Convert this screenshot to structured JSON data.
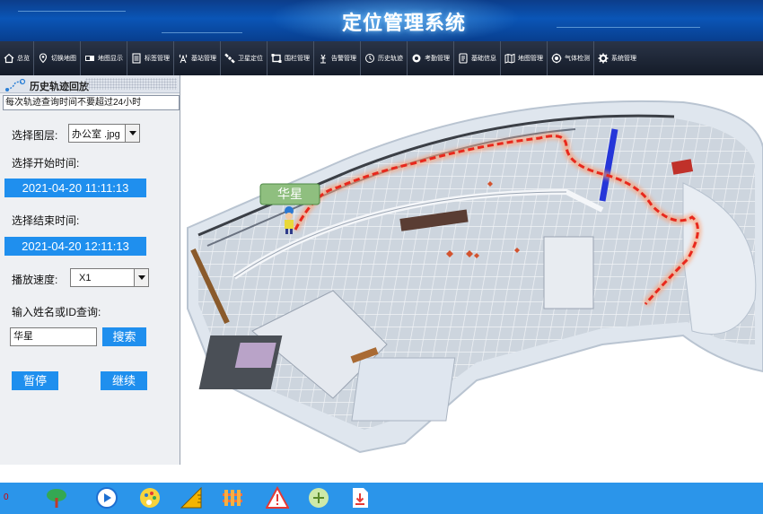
{
  "header": {
    "title": "定位管理系统"
  },
  "nav": {
    "items": [
      {
        "label": "总览",
        "icon": "home-icon"
      },
      {
        "label": "切换地图",
        "icon": "map-pin-icon"
      },
      {
        "label": "地图显示",
        "icon": "display-icon"
      },
      {
        "label": "标签管理",
        "icon": "tag-list-icon"
      },
      {
        "label": "基站管理",
        "icon": "antenna-icon"
      },
      {
        "label": "卫星定位",
        "icon": "satellite-icon"
      },
      {
        "label": "围栏管理",
        "icon": "fence-icon"
      },
      {
        "label": "告警管理",
        "icon": "alarm-icon"
      },
      {
        "label": "历史轨迹",
        "icon": "history-icon"
      },
      {
        "label": "考勤管理",
        "icon": "attendance-icon"
      },
      {
        "label": "基础信息",
        "icon": "info-doc-icon"
      },
      {
        "label": "地图管理",
        "icon": "map-manage-icon"
      },
      {
        "label": "气体检测",
        "icon": "gas-sensor-icon"
      },
      {
        "label": "系统管理",
        "icon": "gear-icon"
      }
    ]
  },
  "panel": {
    "title": "历史轨迹回放",
    "notice": "每次轨迹查询时间不要超过24小时",
    "layer_label": "选择图层:",
    "layer_value": "办公室 .jpg",
    "start_label": "选择开始时间:",
    "start_value": "2021-04-20 11:11:13",
    "end_label": "选择结束时间:",
    "end_value": "2021-04-20 12:11:13",
    "speed_label": "播放速度:",
    "speed_value": "X1",
    "query_label": "输入姓名或ID查询:",
    "query_value": "华星",
    "search_button": "搜索",
    "pause_button": "暂停",
    "resume_button": "继续"
  },
  "map": {
    "person_label": "华星",
    "trajectory_color": "#e8281c",
    "floor_color": "#c9d2dc"
  },
  "bottom": {
    "count": "0",
    "icons": [
      "tree-icon",
      "play-icon",
      "palette-icon",
      "ruler-icon",
      "fence-tool-icon",
      "warning-icon",
      "add-icon",
      "export-icon"
    ]
  },
  "colors": {
    "accent": "#1f8fee",
    "header": "#0a55b6",
    "navbar": "#1b2332",
    "bottombar": "#2b95ea"
  }
}
